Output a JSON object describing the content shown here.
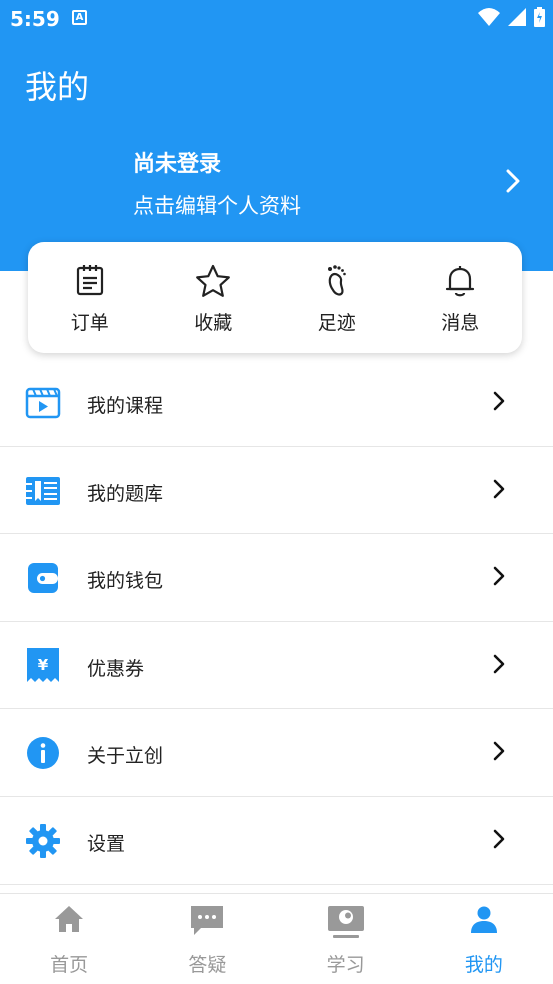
{
  "status_bar": {
    "time": "5:59",
    "notification_icon": "a-icon",
    "icons": [
      "wifi-icon",
      "signal-icon",
      "battery-icon"
    ]
  },
  "header": {
    "title": "我的"
  },
  "profile": {
    "name": "尚未登录",
    "subtitle": "点击编辑个人资料",
    "chevron_icon": "chevron-right-icon"
  },
  "quick_actions": [
    {
      "label": "订单",
      "icon": "clipboard-icon"
    },
    {
      "label": "收藏",
      "icon": "star-icon"
    },
    {
      "label": "足迹",
      "icon": "footprint-icon"
    },
    {
      "label": "消息",
      "icon": "bell-icon"
    }
  ],
  "menu": [
    {
      "label": "我的课程",
      "icon": "video-course-icon"
    },
    {
      "label": "我的题库",
      "icon": "question-bank-icon"
    },
    {
      "label": "我的钱包",
      "icon": "wallet-icon"
    },
    {
      "label": "优惠券",
      "icon": "coupon-icon"
    },
    {
      "label": "关于立创",
      "icon": "info-icon"
    },
    {
      "label": "设置",
      "icon": "settings-icon"
    }
  ],
  "tabs": [
    {
      "label": "首页",
      "icon": "home-icon",
      "active": false
    },
    {
      "label": "答疑",
      "icon": "chat-icon",
      "active": false
    },
    {
      "label": "学习",
      "icon": "study-icon",
      "active": false
    },
    {
      "label": "我的",
      "icon": "person-icon",
      "active": true
    }
  ],
  "colors": {
    "primary": "#2196f3",
    "inactive_tab": "#999999",
    "text": "#222222",
    "divider": "#e6e6e6"
  }
}
